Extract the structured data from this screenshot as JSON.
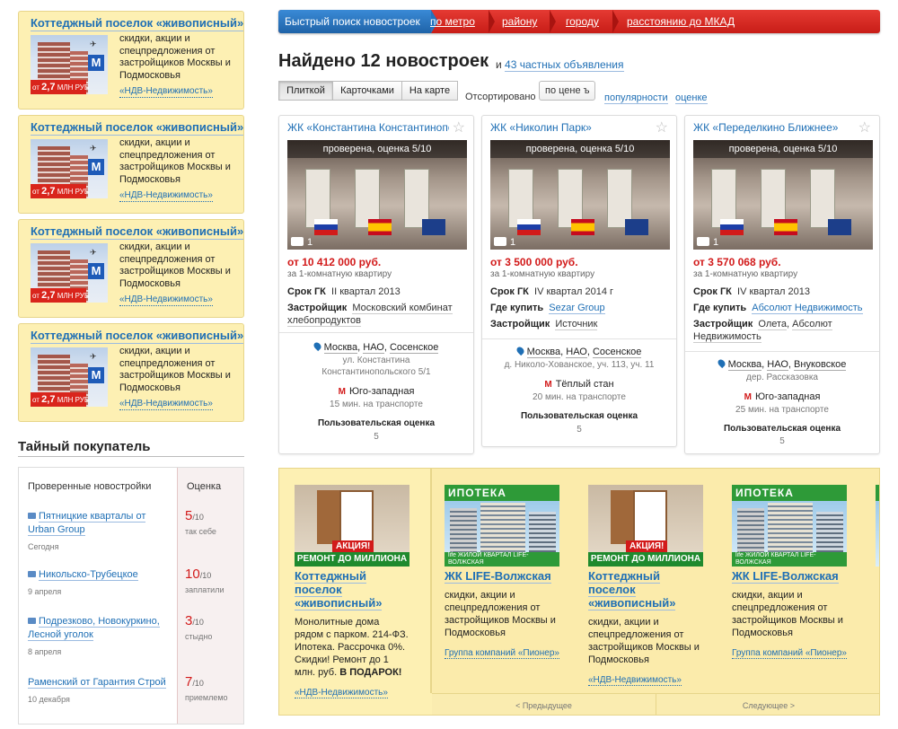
{
  "left_ads": [
    {
      "title": "Коттеджный поселок «живописный»",
      "text": "скидки, акции и спецпредложения от застройщиков Москвы и Подмосковья",
      "source": "«НДВ-Недвижимость»",
      "price_prefix": "от",
      "price_value": "2,7",
      "price_unit": "МЛН РУБ",
      "metro": "М"
    },
    {
      "title": "Коттеджный поселок «живописный»",
      "text": "скидки, акции и спецпредложения от застройщиков Москвы и Подмосковья",
      "source": "«НДВ-Недвижимость»",
      "price_prefix": "от",
      "price_value": "2,7",
      "price_unit": "МЛН РУБ",
      "metro": "М"
    },
    {
      "title": "Коттеджный поселок «живописный»",
      "text": "скидки, акции и спецпредложения от застройщиков Москвы и Подмосковья",
      "source": "«НДВ-Недвижимость»",
      "price_prefix": "от",
      "price_value": "2,7",
      "price_unit": "МЛН РУБ",
      "metro": "М"
    },
    {
      "title": "Коттеджный поселок «живописный»",
      "text": "скидки, акции и спецпредложения от застройщиков Москвы и Подмосковья",
      "source": "«НДВ-Недвижимость»",
      "price_prefix": "от",
      "price_value": "2,7",
      "price_unit": "МЛН РУБ",
      "metro": "М"
    }
  ],
  "mystery": {
    "title": "Тайный покупатель",
    "col_left": "Проверенные новостройки",
    "col_right": "Оценка",
    "rows": [
      {
        "name": "Пятницкие кварталы \u0001от Urban Group",
        "date": "Сегодня",
        "score": "5",
        "of": "/10",
        "comment": "так себе"
      },
      {
        "name": "Никольско-Трубецкое",
        "date": "9 апреля",
        "score": "10",
        "of": "/10",
        "comment": "заплатили"
      },
      {
        "name": "Подрезково, Новокуркино, Лесной уголок",
        "date": "8 апреля",
        "score": "3",
        "of": "/10",
        "comment": "стыдно"
      },
      {
        "name": "Раменский от Гарантия Строй",
        "date": "10 декабря",
        "score": "7",
        "of": "/10",
        "comment": "приемлемо"
      }
    ]
  },
  "topnav": {
    "first": "Быстрый поиск новостроек",
    "items": [
      "по метро",
      "району",
      "городу",
      "расстоянию до МКАД"
    ]
  },
  "found": {
    "title": "Найдено 12 новостроек",
    "and": "и",
    "private_link": "43 частных объявления"
  },
  "view": {
    "buttons": [
      "Плиткой",
      "Карточками",
      "На карте"
    ],
    "sort_label": "Отсортировано",
    "sort_value": "по цене ъ",
    "sort_popularity": "популярности",
    "sort_rating": "оценке"
  },
  "cards": [
    {
      "title": "ЖК «Константина Константинопо",
      "badge": "проверена, оценка 5/10",
      "photo_count": "1",
      "price": "от 10 412 000 руб.",
      "price_sub": "за 1-комнатную квартиру",
      "f1_label": "Срок ГК",
      "f1_value": "II квартал 2013",
      "f2_label": "Застройщик",
      "f2_value": "Московский комбинат хлебопродуктов",
      "city": "Москва",
      "district": "НАО",
      "area": "Сосенское",
      "address": "ул. Константина Константинопольского 5/1",
      "metro_icon": "М",
      "metro": "Юго-западная",
      "metro_time": "15 мин. на транспорте",
      "rating_label": "Пользовательская оценка",
      "rating": "5"
    },
    {
      "title": "ЖК «Николин Парк»",
      "badge": "проверена, оценка 5/10",
      "photo_count": "1",
      "price": "от 3 500 000 руб.",
      "price_sub": "за 1-комнатную квартиру",
      "f1_label": "Срок ГК",
      "f1_value": "IV квартал 2014 г",
      "f2_label": "Где купить",
      "f2_value": "Sezar Group",
      "f3_label": "Застройщик",
      "f3_value": "Источник",
      "city": "Москва",
      "district": "НАО",
      "area": "Сосенское",
      "address": "д. Николо-Хованское, уч. 113, уч. 11",
      "metro_icon": "М",
      "metro": "Тёплый стан",
      "metro_time": "20 мин. на транспорте",
      "rating_label": "Пользовательская оценка",
      "rating": "5"
    },
    {
      "title": "ЖК «Переделкино Ближнее»",
      "badge": "проверена, оценка 5/10",
      "photo_count": "1",
      "price": "от 3 570 068 руб.",
      "price_sub": "за 1-комнатную квартиру",
      "f1_label": "Срок ГК",
      "f1_value": "IV квартал 2013",
      "f2_label": "Где купить",
      "f2_value": "Абсолют Недвижимость",
      "f3_label": "Застройщик",
      "f3_value": "Олета",
      "f3_value2": "Абсолют Недвижимость",
      "city": "Москва",
      "district": "НАО",
      "area": "Внуковское",
      "address": "дер. Рассказовка",
      "metro_icon": "М",
      "metro": "Юго-западная",
      "metro_time": "25 мин. на транспорте",
      "rating_label": "Пользовательская оценка",
      "rating": "5"
    }
  ],
  "carousel": {
    "items": [
      {
        "banner_top": "",
        "banner_action": "АКЦИЯ!",
        "banner_bottom": "РЕМОНТ ДО МИЛЛИОНА",
        "title": "Коттеджный поселок «живописный»",
        "desc": "Монолитные дома рядом с парком. 214-ФЗ. Ипотека. Рассрочка 0%. Скидки! Ремонт до 1 млн. руб.",
        "desc_bold": "В ПОДАРОК!",
        "source": "«НДВ-Недвижимость»"
      },
      {
        "banner_top": "ИПОТЕКА",
        "banner_bottom": "life ЖИЛОЙ КВАРТАЛ LIFE-ВОЛЖСКАЯ",
        "title": "ЖК LIFE-Волжская",
        "desc": "скидки, акции и спецпредложения от застройщиков Москвы и Подмосковья",
        "source": "Группа компаний «Пионер»"
      },
      {
        "banner_action": "АКЦИЯ!",
        "banner_bottom": "РЕМОНТ ДО МИЛЛИОНА",
        "title": "Коттеджный поселок «живописный»",
        "desc": "скидки, акции и спецпредложения от застройщиков Москвы и Подмосковья",
        "source": "«НДВ-Недвижимость»"
      },
      {
        "banner_top": "ИПОТЕКА",
        "banner_bottom": "life ЖИЛОЙ КВАРТАЛ LIFE-ВОЛЖСКАЯ",
        "title": "ЖК LIFE-Волжская",
        "desc": "скидки, акции и спецпредложения от застройщиков Москвы и Подмосковья",
        "source": "Группа компаний «Пионер»"
      }
    ],
    "prev": "< Предыдущее",
    "next": "Следующее >"
  }
}
